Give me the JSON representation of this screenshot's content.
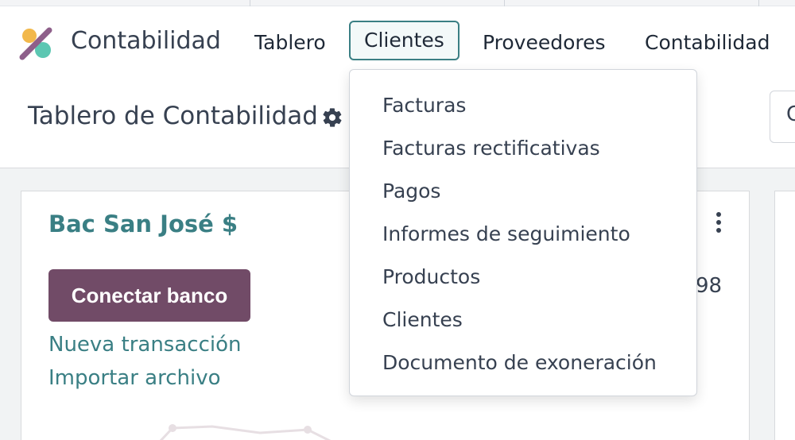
{
  "app": {
    "name": "Contabilidad"
  },
  "nav": {
    "items": [
      {
        "label": "Tablero"
      },
      {
        "label": "Clientes",
        "active": true
      },
      {
        "label": "Proveedores"
      },
      {
        "label": "Contabilidad"
      }
    ]
  },
  "control_panel": {
    "title": "Tablero de Contabilidad",
    "search_partial": "C"
  },
  "dropdown": {
    "items": [
      {
        "label": "Facturas"
      },
      {
        "label": "Facturas rectificativas"
      },
      {
        "label": "Pagos"
      },
      {
        "label": "Informes de seguimiento"
      },
      {
        "label": "Productos"
      },
      {
        "label": "Clientes"
      },
      {
        "label": "Documento de exoneración"
      }
    ]
  },
  "journal_card": {
    "title": "Bac San José $",
    "connect_label": "Conectar banco",
    "new_transaction": "Nueva transacción",
    "import_file": "Importar archivo",
    "partial_value": "98"
  },
  "colors": {
    "accent": "#3a7f84",
    "primary_button": "#714b67"
  }
}
